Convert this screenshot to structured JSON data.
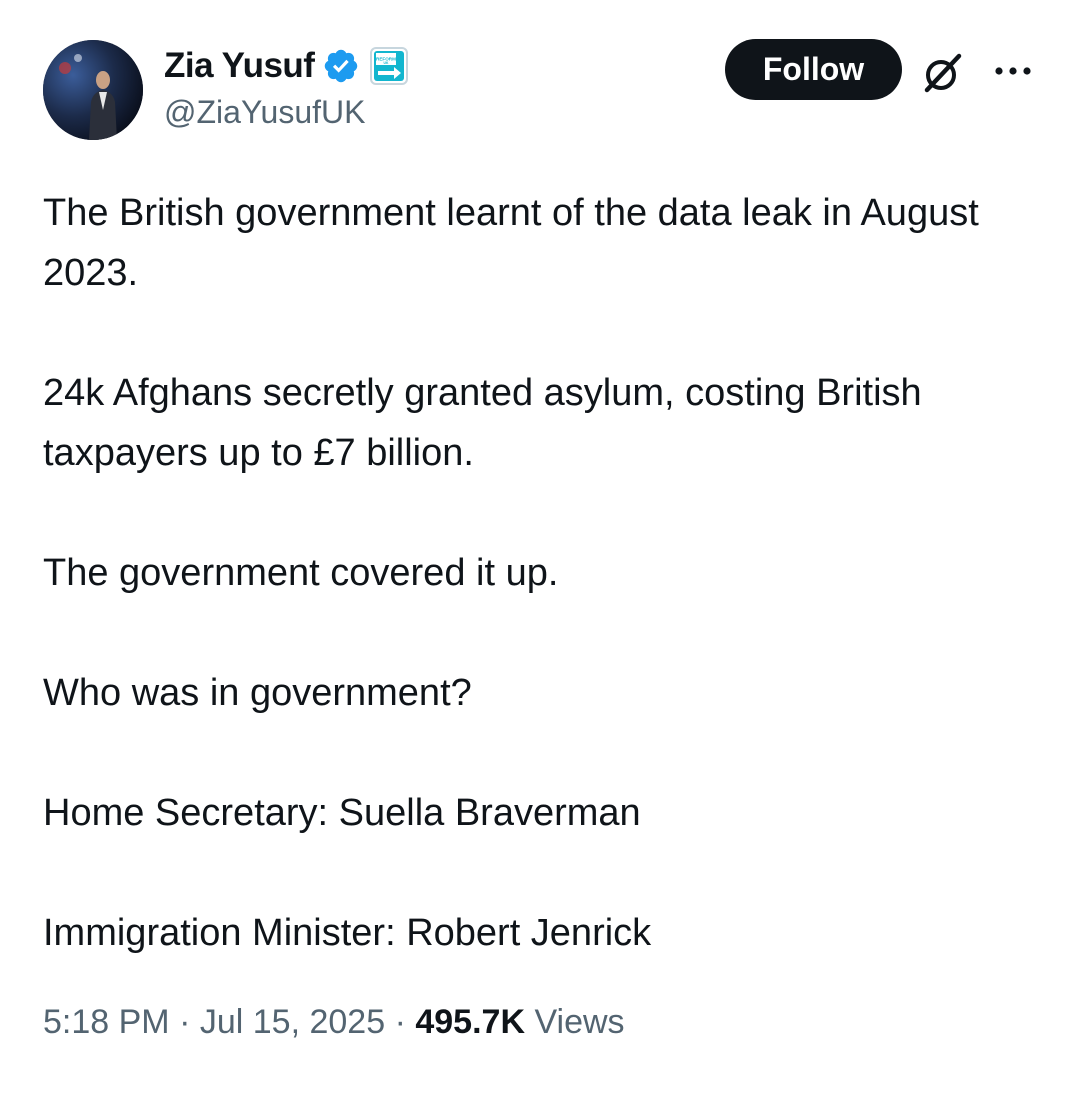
{
  "author": {
    "display_name": "Zia Yusuf",
    "handle": "@ZiaYusufUK",
    "badge_color": "#1d9bf0",
    "party_badge_text": "REFORM UK"
  },
  "actions": {
    "follow_label": "Follow",
    "grok_icon": "grok-icon",
    "more_icon": "more-options-icon"
  },
  "tweet": {
    "paragraphs": [
      "The British government learnt of the data leak in August 2023.",
      "24k Afghans secretly granted asylum, costing British taxpayers up to £7 billion.",
      "The government covered it up.",
      "Who was in government?",
      "Home Secretary: Suella Braverman",
      "Immigration Minister: Robert Jenrick"
    ]
  },
  "meta": {
    "time": "5:18 PM",
    "separator": "·",
    "date": "Jul 15, 2025",
    "views_count": "495.7K",
    "views_label": "Views"
  }
}
